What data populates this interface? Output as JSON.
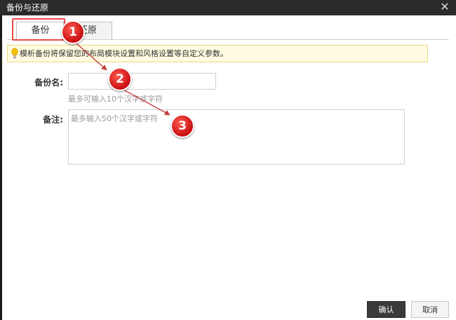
{
  "window": {
    "title": "备份与还原",
    "close_icon": "close-icon"
  },
  "tabs": [
    {
      "label": "备份"
    },
    {
      "label": "还原"
    }
  ],
  "notice": {
    "text": "模析备份将保留您的布局模块设置和风格设置等自定义参数。",
    "icon": "lightbulb-icon"
  },
  "form": {
    "backup_name_label": "备份名:",
    "backup_name_value": "",
    "backup_name_hint": "最多可输入10个汉字或字符",
    "note_label": "备注:",
    "note_placeholder": "最多输入50个汉字或字符"
  },
  "buttons": {
    "confirm": "确认",
    "cancel": "取消"
  },
  "annotations": {
    "markers": [
      "1",
      "2",
      "3"
    ],
    "marker_color": "#d8121a",
    "arrow_color": "#c43a3a"
  }
}
